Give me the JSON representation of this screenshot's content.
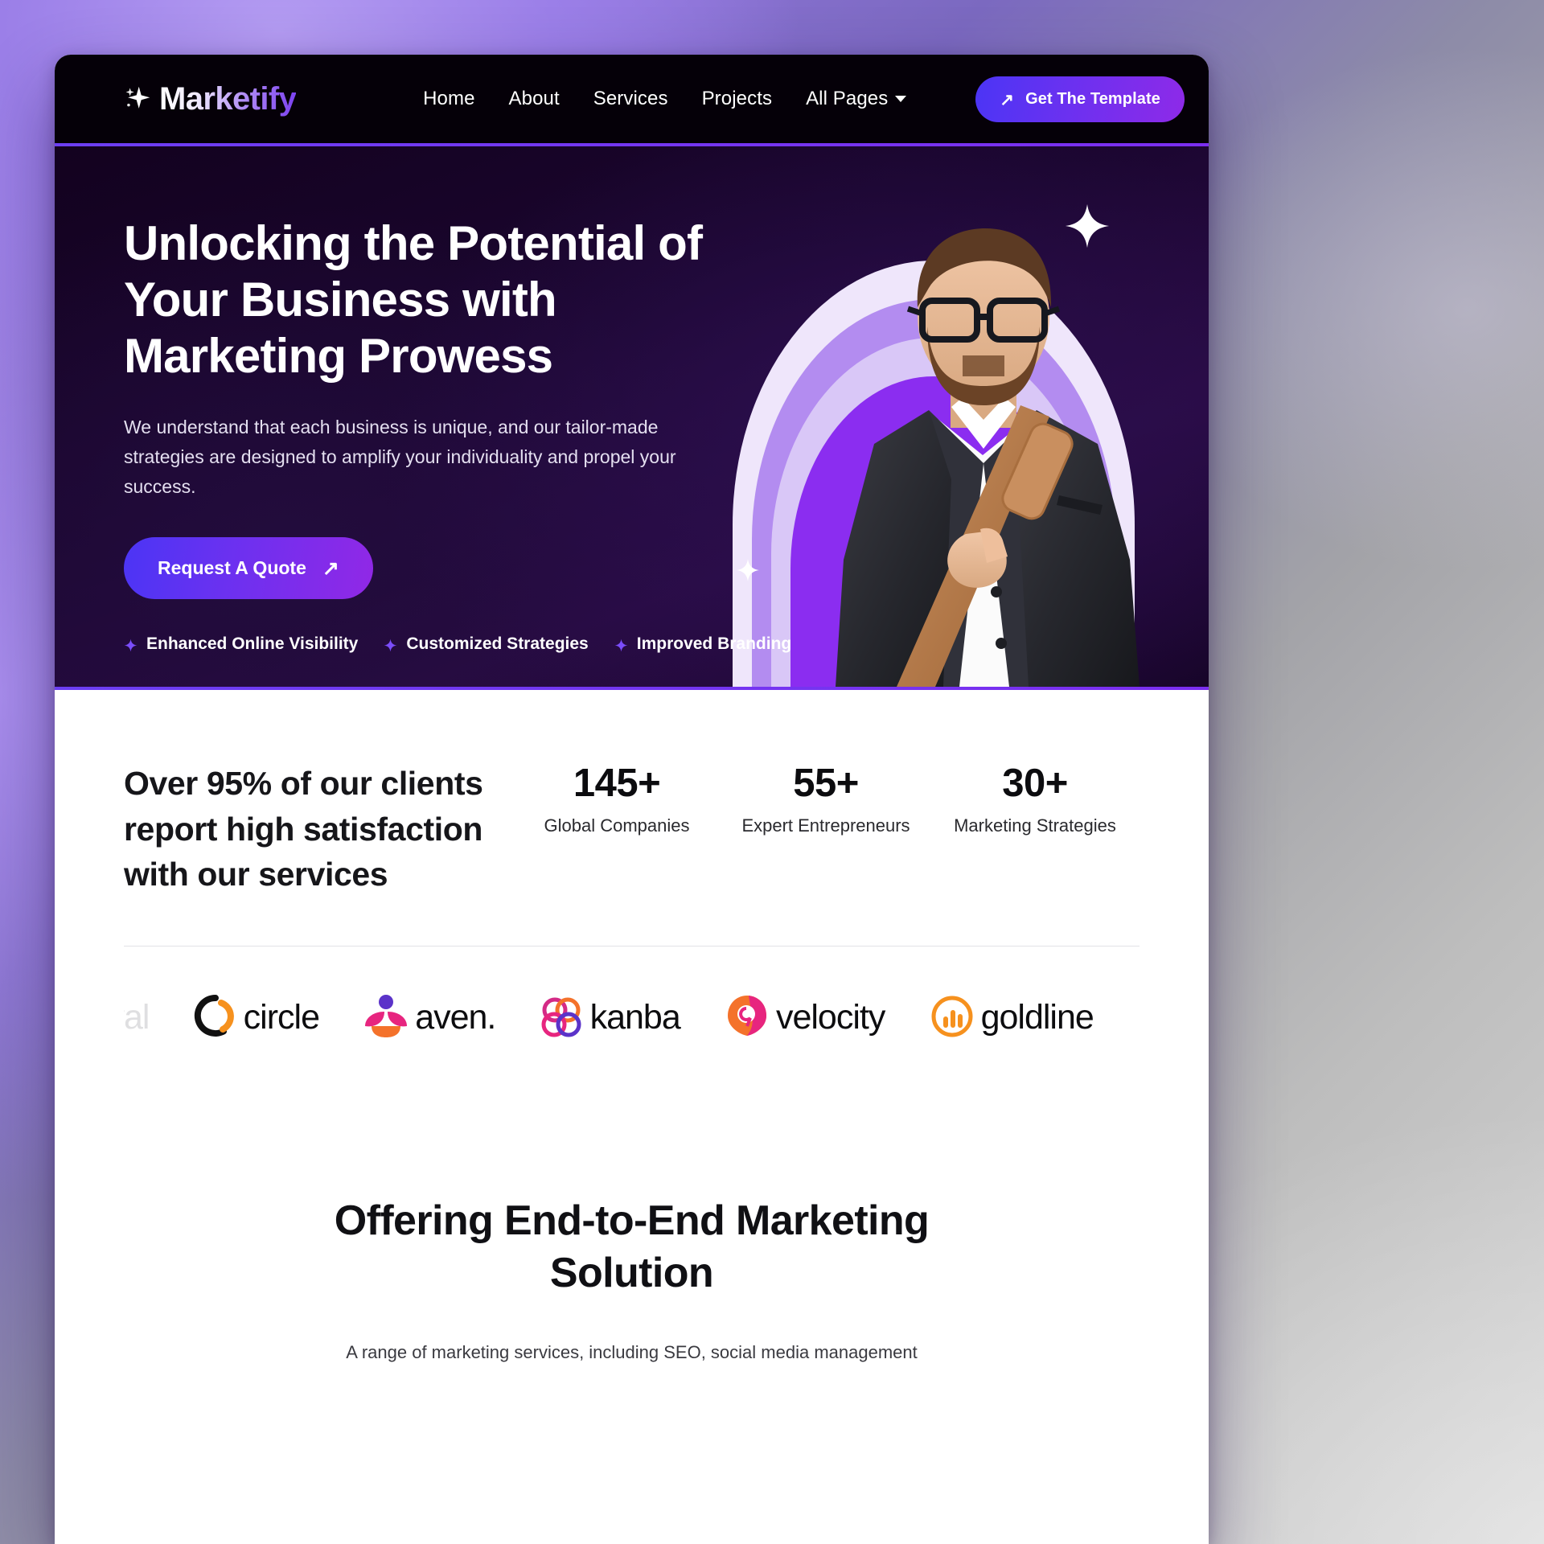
{
  "brand": {
    "name": "Marketify",
    "spark_icon": "sparkle-icon"
  },
  "nav": {
    "links": [
      {
        "label": "Home"
      },
      {
        "label": "About"
      },
      {
        "label": "Services"
      },
      {
        "label": "Projects"
      }
    ],
    "dropdown": {
      "label": "All Pages",
      "caret_icon": "chevron-down-icon"
    },
    "cta": {
      "label": "Get The Template",
      "icon": "arrow-up-right-icon"
    }
  },
  "hero": {
    "heading": "Unlocking the Potential of Your Business with Marketing Prowess",
    "subtext": "We understand that each business is unique, and our tailor-made strategies are designed to amplify your individuality and propel your success.",
    "cta": {
      "label": "Request A Quote",
      "icon": "arrow-up-right-icon"
    },
    "features": [
      {
        "label": "Enhanced Online Visibility"
      },
      {
        "label": "Customized Strategies"
      },
      {
        "label": "Improved Branding"
      }
    ],
    "image_alt": "businessman-with-glasses-and-shoulder-bag"
  },
  "stats_section": {
    "heading": "Over 95% of our clients report high satisfaction with our services",
    "stats": [
      {
        "value": "145+",
        "label": "Global Companies"
      },
      {
        "value": "55+",
        "label": "Expert Entrepreneurs"
      },
      {
        "value": "30+",
        "label": "Marketing Strategies"
      }
    ]
  },
  "logos": [
    {
      "name": "dival",
      "mark": "none"
    },
    {
      "name": "circle",
      "mark": "circle-ring-mark"
    },
    {
      "name": "aven.",
      "mark": "lotus-mark"
    },
    {
      "name": "kanba",
      "mark": "interlocking-circles-mark"
    },
    {
      "name": "velocity",
      "mark": "pin-nine-mark"
    },
    {
      "name": "goldline",
      "mark": "bar-chart-sun-mark"
    },
    {
      "name": "",
      "mark": "petal-mark"
    }
  ],
  "end_section": {
    "heading": "Offering End-to-End Marketing Solution",
    "paragraph": "A range of marketing services, including SEO, social media management"
  },
  "colors": {
    "accent_violet": "#7b2ef0",
    "accent_blue_violet": "#4b35f5",
    "hero_bg": "#13021f",
    "nav_bg": "#050008",
    "divider": "#7b2ef0"
  }
}
